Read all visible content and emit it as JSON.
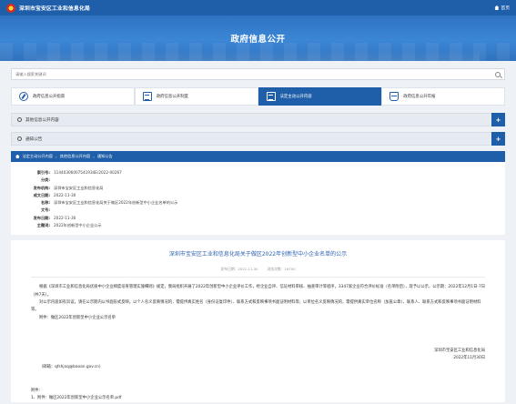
{
  "header": {
    "site_name": "深圳市宝安区工业和信息化局",
    "home_label": "首页"
  },
  "banner": {
    "title": "政府信息公开"
  },
  "search": {
    "placeholder": "请输入搜索关键词"
  },
  "tabs": [
    {
      "label": "政府信息公开指南",
      "icon": "guide-icon",
      "active": false
    },
    {
      "label": "政府信息公开制度",
      "icon": "system-icon",
      "active": false
    },
    {
      "label": "法定主动公开内容",
      "icon": "active-disclosure-icon",
      "active": true
    },
    {
      "label": "政府信息公开年报",
      "icon": "annual-report-icon",
      "active": false
    }
  ],
  "sections": [
    {
      "label": "其他信息公开内容",
      "toggle": "+"
    },
    {
      "label": "通知公告",
      "toggle": "+"
    }
  ],
  "breadcrumb": [
    "法定主动公开内容",
    "其他信息公开内容",
    "通知公告"
  ],
  "meta": [
    {
      "label": "索引号:",
      "value": "11440306007541934E/2022-00267"
    },
    {
      "label": "分类:",
      "value": ""
    },
    {
      "label": "发布机构:",
      "value": "深圳市宝安区工业和信息化局"
    },
    {
      "label": "成文日期:",
      "value": "2022-11-30"
    },
    {
      "label": "名称:",
      "value": "深圳市宝安区工业和信息化局关于做区2022年创新型中小企业名单的公示"
    },
    {
      "label": "文号:",
      "value": ""
    },
    {
      "label": "发布日期:",
      "value": "2022-11-30"
    },
    {
      "label": "主题词:",
      "value": "2022年创新型中小企业公示"
    }
  ],
  "article": {
    "title": "深圳市宝安区工业和信息化局关于做区2022年创新型中小企业名单的公示",
    "publish_info": "发布日期：2022-11-30",
    "views_info": "浏览次数：16700",
    "paragraphs": [
      "根据《深圳市工业和信息化局优质中小企业梯度培育管理实施细则》规定，我局组织开展了2022年创新型中小企业评价工作，经企业自评、信证材料审核、抽查审计等程序，3347家企业符合评价标准（名单附后），现予以公示，公示期：2022年12月1日-7日（共7天）。",
      "对公示内容如有异议，请在公示期内以书面形式反映。以个人名义反映情况的，需提供真实姓名（身份证复印件）、联系方式和反映事项书面证明材料等；以单位名义反映情况的，需提供真实单位名称（加盖公章）、联系人、联系方式和反映事项书面证明材料等。",
      "附件：做区2022年创新型中小企业公示名单"
    ],
    "signature_org": "深圳市宝安区工业和信息化局",
    "signature_date": "2022年11月30日",
    "contact": "（邮箱：qfshjxq@baoan.gov.cn）",
    "attachment_title": "附件：",
    "attachment_link": "1、附件：做区2022年创新型中小企业公示名单.pdf"
  }
}
